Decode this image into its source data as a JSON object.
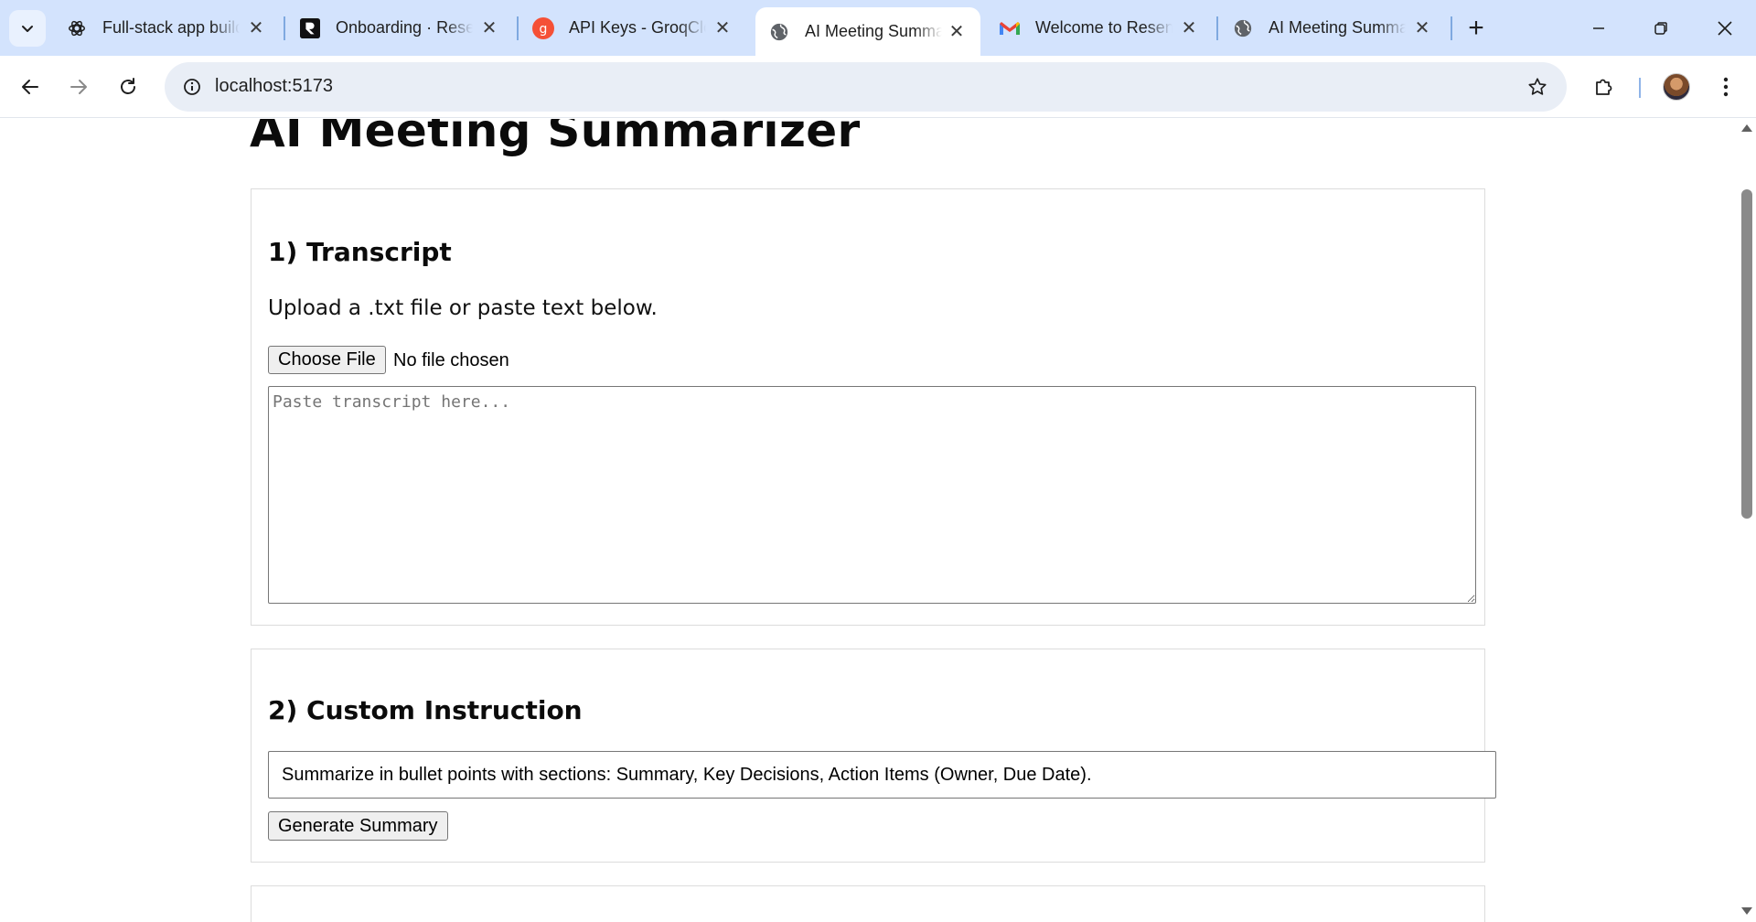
{
  "browser": {
    "tabs": [
      {
        "title": "Full-stack app builder",
        "icon": "openai-icon",
        "active": false
      },
      {
        "title": "Onboarding · Resend",
        "icon": "resend-icon",
        "active": false
      },
      {
        "title": "API Keys - GroqCloud",
        "icon": "groq-icon",
        "active": false
      },
      {
        "title": "AI Meeting Summarizer",
        "icon": "globe-icon",
        "active": true
      },
      {
        "title": "Welcome to Resend",
        "icon": "gmail-icon",
        "active": false
      },
      {
        "title": "AI Meeting Summarizer",
        "icon": "globe-icon",
        "active": false
      }
    ],
    "address": "localhost:5173",
    "colors": {
      "tabstrip": "#d3e3fd",
      "omnibox": "#e9eef6",
      "groq": "#f55036"
    }
  },
  "page": {
    "title": "AI Meeting Summarizer",
    "transcript_section": {
      "heading": "1) Transcript",
      "hint": "Upload a .txt file or paste text below.",
      "file_button": "Choose File",
      "file_status": "No file chosen",
      "placeholder": "Paste transcript here..."
    },
    "instruction_section": {
      "heading": "2) Custom Instruction",
      "value": "Summarize in bullet points with sections: Summary, Key Decisions, Action Items (Owner, Due Date).",
      "button": "Generate Summary"
    }
  }
}
